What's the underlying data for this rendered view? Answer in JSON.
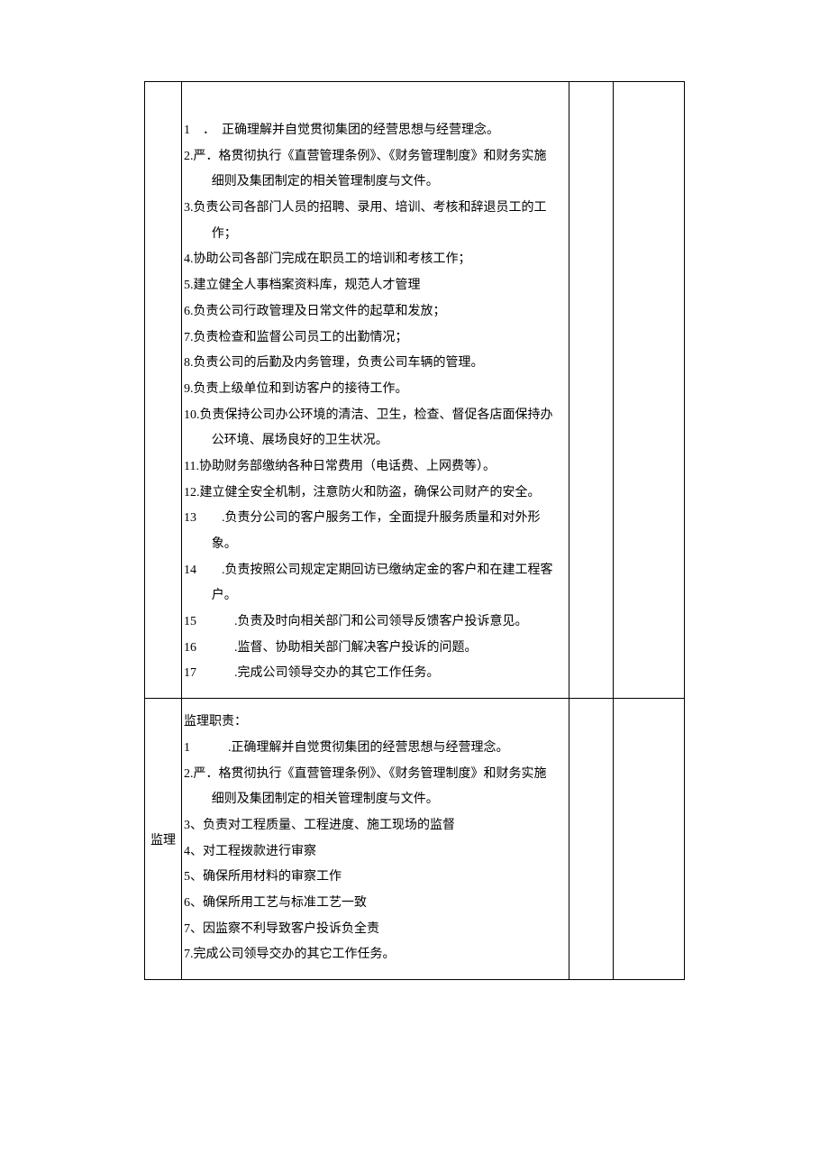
{
  "rows": [
    {
      "role": "",
      "lines": [
        {
          "cls": "top-space",
          "text": ""
        },
        {
          "text": "1　．　正确理解并自觉贯彻集团的经营思想与经营理念。"
        },
        {
          "text": "2.严．格贯彻执行《直营管理条例》、《财务管理制度》和财务实施"
        },
        {
          "text": "细则及集团制定的相关管理制度与文件。",
          "indent": true
        },
        {
          "text": "3.负责公司各部门人员的招聘、录用、培训、考核和辞退员工的工"
        },
        {
          "text": "作；",
          "indent": true
        },
        {
          "text": "4.协助公司各部门完成在职员工的培训和考核工作；"
        },
        {
          "text": "5.建立健全人事档案资料库，规范人才管理"
        },
        {
          "text": "6.负责公司行政管理及日常文件的起草和发放；"
        },
        {
          "text": "7.负责检查和监督公司员工的出勤情况；"
        },
        {
          "text": "8.负责公司的后勤及内务管理，负责公司车辆的管理。"
        },
        {
          "text": "9.负责上级单位和到访客户的接待工作。"
        },
        {
          "text": "10.负责保持公司办公环境的清洁、卫生，检查、督促各店面保持办"
        },
        {
          "text": "公环境、展场良好的卫生状况。",
          "indent": true
        },
        {
          "text": "11.协助财务部缴纳各种日常费用（电话费、上网费等）。"
        },
        {
          "text": "12.建立健全安全机制，注意防火和防盗，确保公司财产的安全。"
        },
        {
          "text": "13　　.负责分公司的客户服务工作，全面提升服务质量和对外形"
        },
        {
          "text": "象。",
          "indent": true
        },
        {
          "text": "14　　.负责按照公司规定定期回访已缴纳定金的客户和在建工程客"
        },
        {
          "text": "户。",
          "indent": true
        },
        {
          "text": "15　　　.负责及时向相关部门和公司领导反馈客户投诉意见。"
        },
        {
          "text": "16　　　.监督、协助相关部门解决客户投诉的问题。"
        },
        {
          "text": "17　　　.完成公司领导交办的其它工作任务。"
        }
      ]
    },
    {
      "role": "监理",
      "lines": [
        {
          "text": "监理职责："
        },
        {
          "text": "1　　　.正确理解并自觉贯彻集团的经营思想与经营理念。"
        },
        {
          "text": "2.严．格贯彻执行《直营管理条例》、《财务管理制度》和财务实施"
        },
        {
          "text": "细则及集团制定的相关管理制度与文件。",
          "indent": true
        },
        {
          "text": "3、负责对工程质量、工程进度、施工现场的监督"
        },
        {
          "text": "4、对工程拨款进行审察"
        },
        {
          "text": "5、确保所用材料的审察工作"
        },
        {
          "text": "6、确保所用工艺与标准工艺一致"
        },
        {
          "text": "7、因监察不利导致客户投诉负全责"
        },
        {
          "text": "7.完成公司领导交办的其它工作任务。"
        }
      ]
    }
  ]
}
